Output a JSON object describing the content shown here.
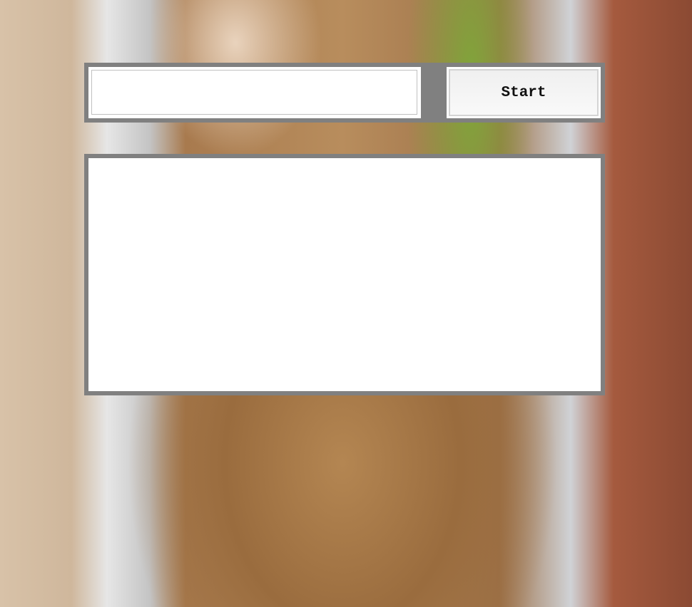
{
  "controls": {
    "input_value": "",
    "input_placeholder": "",
    "start_label": "Start"
  },
  "output": {
    "text": ""
  },
  "colors": {
    "panel_border": "#808080",
    "panel_fill": "#ffffff"
  }
}
